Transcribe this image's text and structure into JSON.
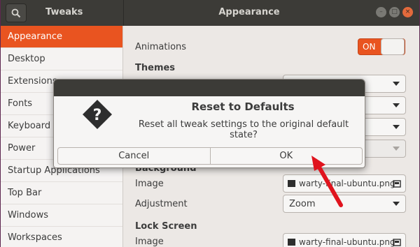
{
  "headerbar": {
    "app_title": "Tweaks",
    "panel_title": "Appearance"
  },
  "sidebar": {
    "items": [
      {
        "label": "Appearance",
        "active": true
      },
      {
        "label": "Desktop",
        "active": false
      },
      {
        "label": "Extensions",
        "active": false
      },
      {
        "label": "Fonts",
        "active": false
      },
      {
        "label": "Keyboard & Mouse",
        "active": false
      },
      {
        "label": "Power",
        "active": false
      },
      {
        "label": "Startup Applications",
        "active": false
      },
      {
        "label": "Top Bar",
        "active": false
      },
      {
        "label": "Windows",
        "active": false
      },
      {
        "label": "Workspaces",
        "active": false
      }
    ]
  },
  "main": {
    "animations_label": "Animations",
    "animations_toggle": "ON",
    "themes_heading": "Themes",
    "background_heading": "Background",
    "background_image_label": "Image",
    "background_image_file": "warty-final-ubuntu.png",
    "background_adjustment_label": "Adjustment",
    "background_adjustment_value": "Zoom",
    "lock_screen_heading": "Lock Screen",
    "lock_image_label": "Image",
    "lock_image_file": "warty-final-ubuntu.png"
  },
  "dialog": {
    "title": "Reset to Defaults",
    "message": "Reset all tweak settings to the original default state?",
    "cancel_label": "Cancel",
    "ok_label": "OK"
  },
  "colors": {
    "accent": "#e95420",
    "headerbar": "#3c3b37",
    "annotation_arrow": "#e0141e"
  }
}
